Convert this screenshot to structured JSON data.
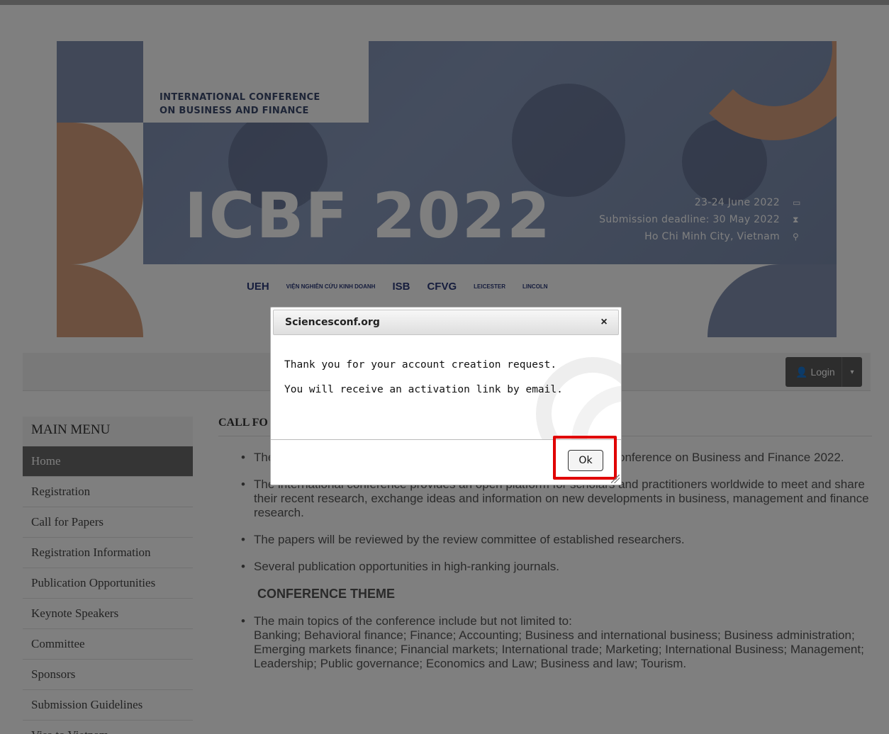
{
  "banner": {
    "subtitle_line1": "INTERNATIONAL CONFERENCE",
    "subtitle_line2": "ON BUSINESS AND FINANCE",
    "title": "ICBF 2022",
    "date": "23-24 June 2022",
    "deadline": "Submission deadline: 30 May 2022",
    "location": "Ho Chi Minh City, Vietnam",
    "logos": [
      "UEH",
      "VIỆN NGHIÊN CỨU KINH DOANH",
      "ISB",
      "CFVG",
      "LEICESTER",
      "LINCOLN"
    ]
  },
  "navbar": {
    "login_label": "Login"
  },
  "sidebar": {
    "title": "MAIN MENU",
    "items": [
      {
        "label": "Home"
      },
      {
        "label": "Registration"
      },
      {
        "label": "Call for Papers"
      },
      {
        "label": "Registration Information"
      },
      {
        "label": "Publication Opportunities"
      },
      {
        "label": "Keynote Speakers"
      },
      {
        "label": "Committee"
      },
      {
        "label": "Sponsors"
      },
      {
        "label": "Submission Guidelines"
      },
      {
        "label": "Visa to Vietnam"
      }
    ]
  },
  "content": {
    "title": "CALL FO",
    "bullet1": "The                                                           mission of research papers in all areas of                                                          e UEH International Conference on Business and Finance 2022.",
    "bullet2": "The international conference provides an open platform for scholars and practitioners worldwide to meet and share their recent research, exchange ideas and information on new developments in business, management and finance research.",
    "bullet3": "The papers will be reviewed by the review committee of established researchers.",
    "bullet4": "Several publication opportunities in high-ranking journals.",
    "theme_heading": "CONFERENCE THEME",
    "bullet5_intro": "The main topics of the conference include but not limited to:",
    "bullet5_topics": "Banking; Behavioral finance; Finance; Accounting;  Business and international business; Business administration; Emerging markets finance;  Financial markets; International trade;  Marketing; International Business;  Management;  Leadership; Public governance; Economics and Law; Business and law; Tourism."
  },
  "dialog": {
    "title": "Sciencesconf.org",
    "close_symbol": "×",
    "message_line1": "Thank you for your account creation request.",
    "message_line2": "You will receive an activation link by email.",
    "ok_label": "Ok"
  },
  "colors": {
    "accent_highlight": "#e00000",
    "banner_blue": "#8391b1",
    "banner_peach": "#d9a17e",
    "overlay": "rgba(0,0,0,0.5)"
  }
}
